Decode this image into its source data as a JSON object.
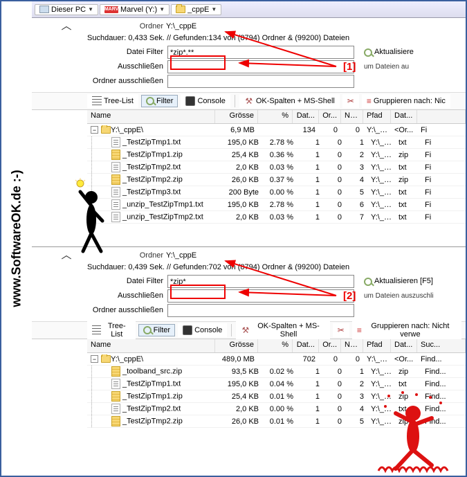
{
  "sidebar_text": "www.SoftwareOK.de :-)",
  "breadcrumb": {
    "pc": "Dieser PC",
    "drive_badge": "MARV",
    "drive": "Marvel (Y:)",
    "folder": "_cppE"
  },
  "panels": [
    {
      "scroll_cue": "︿",
      "ordner_label": "Ordner",
      "ordner_value": "Y:\\_cppE",
      "stats": "Suchdauer: 0,433 Sek. // Gefunden:134 von (8794) Ordner & (99200) Dateien",
      "filter_label": "Datei Filter",
      "filter_value": "*zip*.**",
      "exclude_label": "Ausschließen",
      "exclude_value": "",
      "folder_exclude_label": "Ordner ausschließen",
      "folder_exclude_value": "",
      "refresh": "Aktualisiere",
      "hint": "um Dateien au",
      "annotation": "[1]",
      "toolbar": {
        "tree": "Tree-List",
        "filter": "Filter",
        "console": "Console",
        "ok": "OK-Spalten + MS-Shell",
        "group": "Gruppieren nach: Nic"
      },
      "columns": {
        "name": "Name",
        "size": "Grösse",
        "pct": "%",
        "dat": "Dat...",
        "or": "Or...",
        "nu": "Nu...",
        "pfad": "Pfad",
        "ext": "Dat...",
        "last": ""
      },
      "root_row": {
        "name": "Y:\\_cppE\\",
        "size": "6,9 MB",
        "pct": "",
        "dat": "134",
        "or": "0",
        "nu": "0",
        "pfad": "Y:\\_c...",
        "ext": "<Or...",
        "last": "Fi"
      },
      "rows": [
        {
          "ico": "txt",
          "name": "_TestZipTmp1.txt",
          "size": "195,0 KB",
          "pct": "2.78 %",
          "dat": "1",
          "or": "0",
          "nu": "1",
          "pfad": "Y:\\_c...",
          "ext": "txt",
          "last": "Fi"
        },
        {
          "ico": "zip",
          "name": "_TestZipTmp1.zip",
          "size": "25,4 KB",
          "pct": "0.36 %",
          "dat": "1",
          "or": "0",
          "nu": "2",
          "pfad": "Y:\\_c...",
          "ext": "zip",
          "last": "Fi"
        },
        {
          "ico": "txt",
          "name": "_TestZipTmp2.txt",
          "size": "2,0 KB",
          "pct": "0.03 %",
          "dat": "1",
          "or": "0",
          "nu": "3",
          "pfad": "Y:\\_c...",
          "ext": "txt",
          "last": "Fi"
        },
        {
          "ico": "zip",
          "name": "_TestZipTmp2.zip",
          "size": "26,0 KB",
          "pct": "0.37 %",
          "dat": "1",
          "or": "0",
          "nu": "4",
          "pfad": "Y:\\_c...",
          "ext": "zip",
          "last": "Fi"
        },
        {
          "ico": "txt",
          "name": "_TestZipTmp3.txt",
          "size": "200 Byte",
          "pct": "0.00 %",
          "dat": "1",
          "or": "0",
          "nu": "5",
          "pfad": "Y:\\_c...",
          "ext": "txt",
          "last": "Fi"
        },
        {
          "ico": "txt",
          "name": "_unzip_TestZipTmp1.txt",
          "size": "195,0 KB",
          "pct": "2.78 %",
          "dat": "1",
          "or": "0",
          "nu": "6",
          "pfad": "Y:\\_c...",
          "ext": "txt",
          "last": "Fi"
        },
        {
          "ico": "txt",
          "name": "_unzip_TestZipTmp2.txt",
          "size": "2,0 KB",
          "pct": "0.03 %",
          "dat": "1",
          "or": "0",
          "nu": "7",
          "pfad": "Y:\\_c...",
          "ext": "txt",
          "last": "Fi"
        }
      ]
    },
    {
      "scroll_cue": "︿",
      "ordner_label": "Ordner",
      "ordner_value": "Y:\\_cppE",
      "stats": "Suchdauer: 0,439 Sek. // Gefunden:702 von (8794) Ordner & (99200) Dateien",
      "filter_label": "Datei Filter",
      "filter_value": "*zip*",
      "exclude_label": "Ausschließen",
      "exclude_value": "",
      "folder_exclude_label": "Ordner ausschließen",
      "folder_exclude_value": "",
      "refresh": "Aktualisieren [F5]",
      "hint": "um Dateien auszuschli",
      "annotation": "[2]",
      "toolbar": {
        "tree": "Tree-List",
        "filter": "Filter",
        "console": "Console",
        "ok": "OK-Spalten + MS-Shell",
        "group": "Gruppieren nach: Nicht verwe"
      },
      "columns": {
        "name": "Name",
        "size": "Grösse",
        "pct": "%",
        "dat": "Dat...",
        "or": "Or...",
        "nu": "Nu...",
        "pfad": "Pfad",
        "ext": "Dat...",
        "last": "Suc..."
      },
      "root_row": {
        "name": "Y:\\_cppE\\",
        "size": "489,0 MB",
        "pct": "",
        "dat": "702",
        "or": "0",
        "nu": "0",
        "pfad": "Y:\\_c...",
        "ext": "<Or...",
        "last": "Find..."
      },
      "rows": [
        {
          "ico": "zip",
          "name": "_toolband_src.zip",
          "size": "93,5 KB",
          "pct": "0.02 %",
          "dat": "1",
          "or": "0",
          "nu": "1",
          "pfad": "Y:\\_c...",
          "ext": "zip",
          "last": "Find..."
        },
        {
          "ico": "txt",
          "name": "_TestZipTmp1.txt",
          "size": "195,0 KB",
          "pct": "0.04 %",
          "dat": "1",
          "or": "0",
          "nu": "2",
          "pfad": "Y:\\_c...",
          "ext": "txt",
          "last": "Find..."
        },
        {
          "ico": "zip",
          "name": "_TestZipTmp1.zip",
          "size": "25,4 KB",
          "pct": "0.01 %",
          "dat": "1",
          "or": "0",
          "nu": "3",
          "pfad": "Y:\\_c...",
          "ext": "zip",
          "last": "Find..."
        },
        {
          "ico": "txt",
          "name": "_TestZipTmp2.txt",
          "size": "2,0 KB",
          "pct": "0.00 %",
          "dat": "1",
          "or": "0",
          "nu": "4",
          "pfad": "Y:\\_c...",
          "ext": "txt",
          "last": "Find..."
        },
        {
          "ico": "zip",
          "name": "_TestZipTmp2.zip",
          "size": "26,0 KB",
          "pct": "0.01 %",
          "dat": "1",
          "or": "0",
          "nu": "5",
          "pfad": "Y:\\_c...",
          "ext": "zip",
          "last": "Find..."
        }
      ]
    }
  ]
}
